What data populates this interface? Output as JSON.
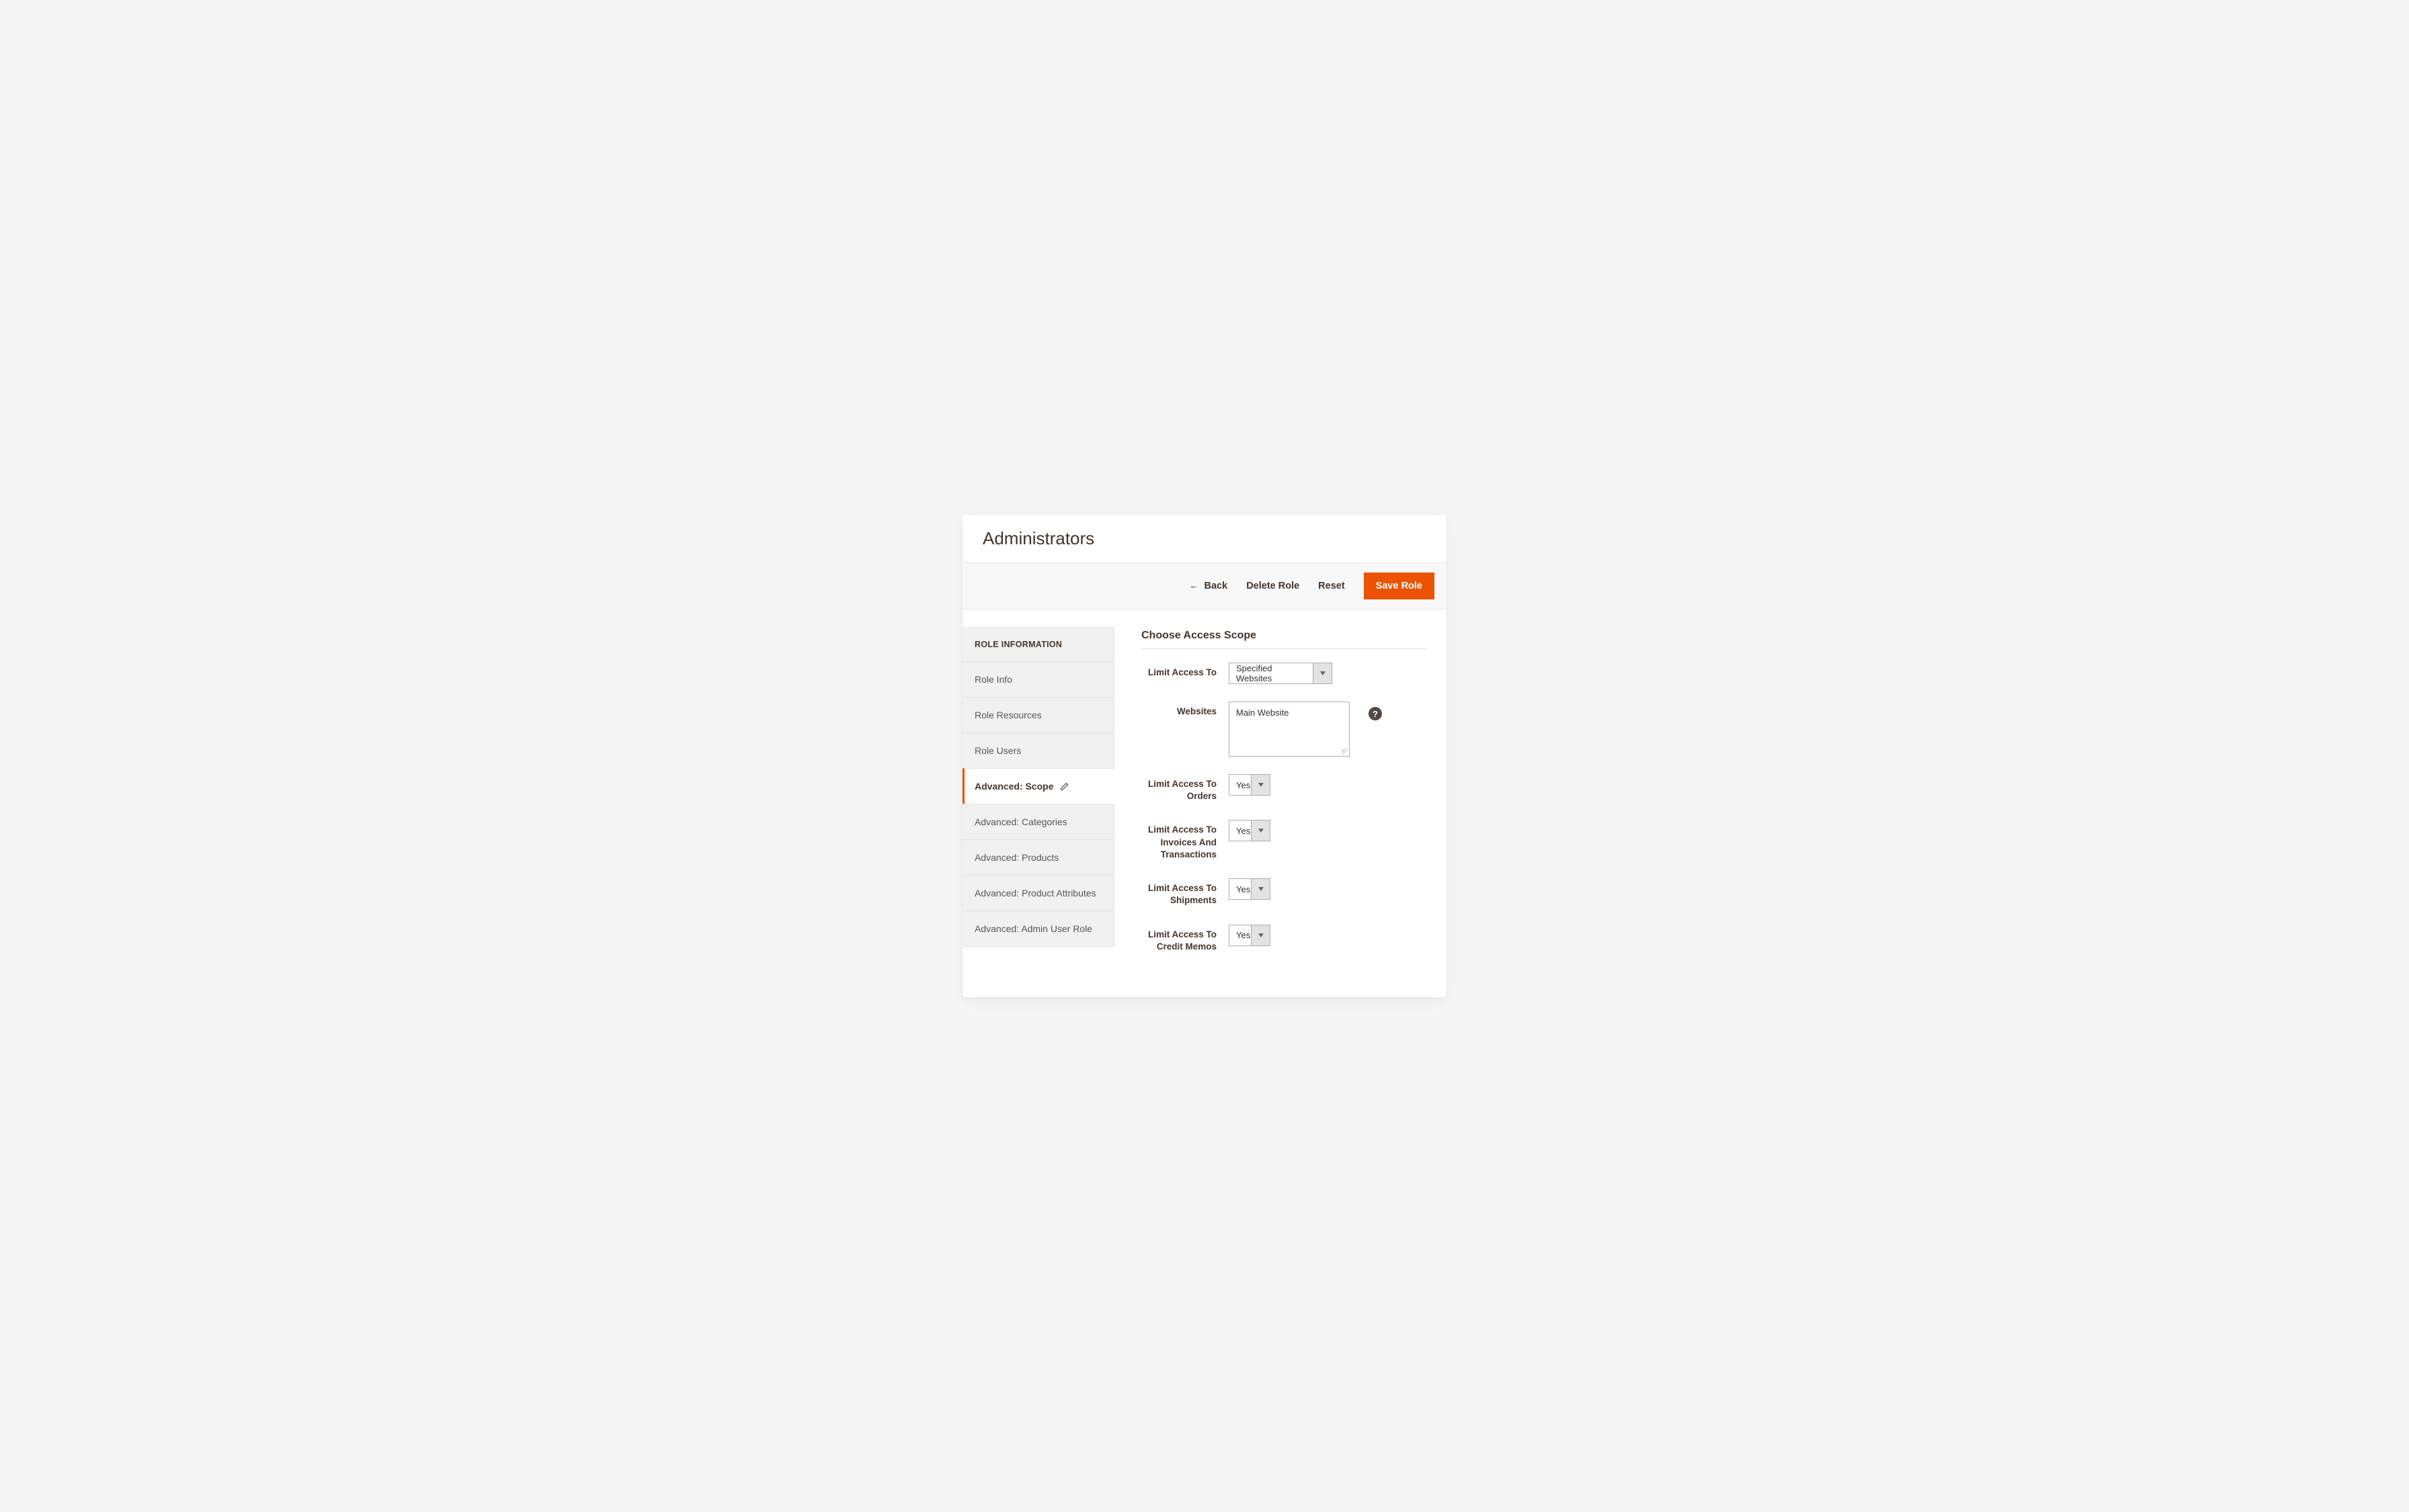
{
  "header": {
    "title": "Administrators"
  },
  "toolbar": {
    "back_label": "Back",
    "delete_label": "Delete Role",
    "reset_label": "Reset",
    "save_label": "Save Role"
  },
  "sidebar": {
    "title": "ROLE INFORMATION",
    "items": [
      {
        "label": "Role Info",
        "active": false
      },
      {
        "label": "Role Resources",
        "active": false
      },
      {
        "label": "Role Users",
        "active": false
      },
      {
        "label": "Advanced: Scope",
        "active": true
      },
      {
        "label": "Advanced: Categories",
        "active": false
      },
      {
        "label": "Advanced: Products",
        "active": false
      },
      {
        "label": "Advanced: Product Attributes",
        "active": false
      },
      {
        "label": "Advanced: Admin User Role",
        "active": false
      }
    ]
  },
  "main": {
    "section_title": "Choose Access Scope",
    "fields": {
      "limit_access_to": {
        "label": "Limit Access To",
        "value": "Specified Websites"
      },
      "websites": {
        "label": "Websites",
        "value": "Main Website",
        "help": "?"
      },
      "limit_orders": {
        "label": "Limit Access To Orders",
        "value": "Yes"
      },
      "limit_invoices": {
        "label": "Limit Access To Invoices And Transactions",
        "value": "Yes"
      },
      "limit_shipments": {
        "label": "Limit Access To Shipments",
        "value": "Yes"
      },
      "limit_credit_memos": {
        "label": "Limit Access To Credit Memos",
        "value": "Yes"
      }
    }
  }
}
